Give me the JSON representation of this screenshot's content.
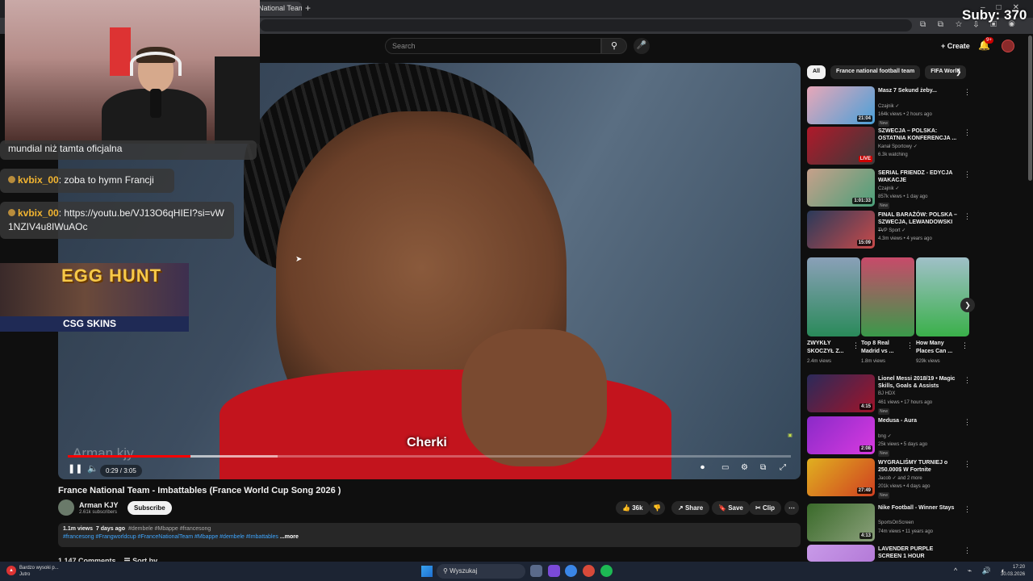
{
  "browser": {
    "tab_title": "National Team",
    "overlay_counter": "Suby: 370"
  },
  "youtube": {
    "search_placeholder": "Search",
    "create_label": "Create",
    "notif_count": "9+"
  },
  "video": {
    "subtitle": "Cherki",
    "watermark": "Arman kjy",
    "time": "0:29 / 3:05",
    "progress": 0.17,
    "title": "France National Team - Imbattables (France World Cup Song 2026 )",
    "channel": "Arman KJY",
    "subscribers": "2.61k subscribers",
    "subscribe_label": "Subscribe",
    "likes": "36k",
    "share_label": "Share",
    "save_label": "Save",
    "clip_label": "Clip",
    "description": {
      "views": "1.1m views",
      "age": "7 days ago",
      "tags": "#dembele #Mbappe #francesong",
      "hashtags": "#francesong #Frangworldcup #FranceNationalTeam #Mbappe #dembele #Imbattables",
      "more_label": "...more"
    },
    "comments_label": "1,147 Comments",
    "sort_label": "Sort by"
  },
  "chat": [
    {
      "user": "",
      "text": "mundial niż tamta oficjalna"
    },
    {
      "user": "kvbix_00",
      "text": ": zoba to hymn Francji"
    },
    {
      "user": "kvbix_00",
      "text": ": https://youtu.be/VJ13O6qHIEI?si=vW1NZIV4u8IWuAOc"
    }
  ],
  "ad": {
    "title": "EGG HUNT",
    "brand": "CSG SKINS"
  },
  "chips": [
    "All",
    "France national football team",
    "FIFA World"
  ],
  "recommendations": [
    {
      "title": "Masz 7 Sekund żeby...",
      "channel": "Czajnik ✓",
      "meta": "164k views • 2 hours ago",
      "duration": "21:04",
      "badge": "New",
      "colors": [
        "#e8a7b8",
        "#4aa0d8"
      ]
    },
    {
      "title": "SZWECJA – POLSKA: OSTATNIA KONFERENCJA ...",
      "channel": "Kanał Sportowy ✓",
      "meta": "6.3k watching",
      "duration": "LIVE",
      "badge": "",
      "colors": [
        "#b0192a",
        "#3a3a3a"
      ]
    },
    {
      "title": "SERIAL FRIENDZ - EDYCJA WAKACJE",
      "channel": "Czajnik ✓",
      "meta": "857k views • 1 day ago",
      "duration": "1:01:33",
      "badge": "New",
      "colors": [
        "#c7a08a",
        "#4aa07a"
      ]
    },
    {
      "title": "FINAL BARAŻÓW: POLSKA – SZWECJA, LEWANDOWSKI ...",
      "channel": "TVP Sport ✓",
      "meta": "4.3m views • 4 years ago",
      "duration": "15:09",
      "badge": "",
      "colors": [
        "#2a3a5a",
        "#c84a4a"
      ]
    },
    {
      "title": "Lionel Messi 2018/19 • Magic Skills, Goals & Assists",
      "channel": "BJ HDX",
      "meta": "461 views • 17 hours ago",
      "duration": "4:15",
      "badge": "New",
      "colors": [
        "#2a2a5a",
        "#a0142a"
      ]
    },
    {
      "title": "Medusa - Aura",
      "channel": "bng ✓",
      "meta": "25k views • 5 days ago",
      "duration": "2:08",
      "badge": "New",
      "colors": [
        "#8a2ac8",
        "#d83ae0"
      ]
    },
    {
      "title": "WYGRALIŚMY TURNIEJ o 250.000$ W Fortnite",
      "channel": "Jacob ✓ and 2 more",
      "meta": "201k views • 4 days ago",
      "duration": "27:49",
      "badge": "New",
      "colors": [
        "#e0b020",
        "#d04020"
      ]
    },
    {
      "title": "Nike Football - Winner Stays",
      "channel": "SportsOnScreen",
      "meta": "74m views • 11 years ago",
      "duration": "4:13",
      "badge": "",
      "colors": [
        "#3a6a2a",
        "#8aa07a"
      ]
    },
    {
      "title": "LAVENDER PURPLE SCREEN 1 HOUR",
      "channel": "",
      "meta": "",
      "duration": "",
      "badge": "",
      "colors": [
        "#c89ae8",
        "#b47ad8"
      ]
    }
  ],
  "shorts": [
    {
      "title": "ZWYKŁY SKOCZYŁ Z...",
      "views": "2.4m views",
      "colors": [
        "#8aa0b8",
        "#2a8a5a"
      ]
    },
    {
      "title": "Top 8 Real Madrid vs ...",
      "views": "1.8m views",
      "colors": [
        "#c84a6a",
        "#3a9a4a"
      ]
    },
    {
      "title": "How Many Places Can ...",
      "views": "929k views",
      "colors": [
        "#a0c0c8",
        "#3ab04a"
      ]
    }
  ],
  "taskbar": {
    "notif_title": "Bardzo wysoki p...",
    "notif_sub": "Jutro",
    "search_label": "Wyszukaj",
    "time": "17:20",
    "date": "30.03.2026"
  }
}
